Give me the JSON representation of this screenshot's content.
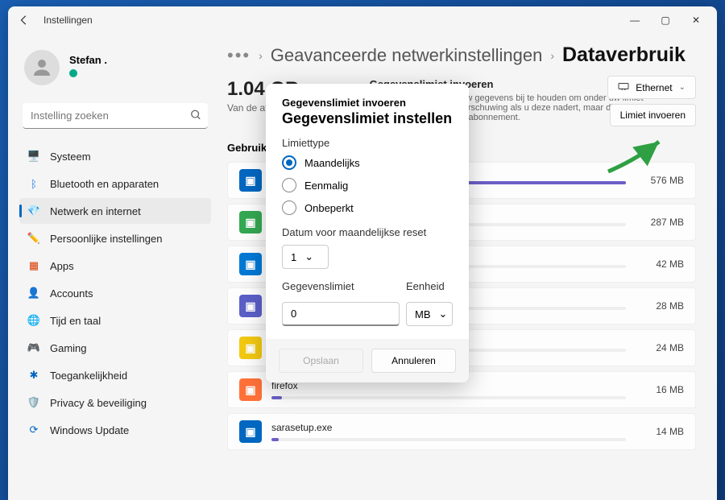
{
  "window": {
    "title": "Instellingen"
  },
  "account": {
    "name": "Stefan ."
  },
  "search": {
    "placeholder": "Instelling zoeken"
  },
  "sidebar": {
    "items": [
      {
        "label": "Systeem",
        "icon": "🖥️",
        "color": "#1a73e8"
      },
      {
        "label": "Bluetooth en apparaten",
        "icon": "ᛒ",
        "color": "#1a73e8"
      },
      {
        "label": "Netwerk en internet",
        "icon": "💎",
        "color": "#1a73e8",
        "active": true
      },
      {
        "label": "Persoonlijke instellingen",
        "icon": "✏️",
        "color": "#b36b00"
      },
      {
        "label": "Apps",
        "icon": "▦",
        "color": "#d83b01"
      },
      {
        "label": "Accounts",
        "icon": "👤",
        "color": "#5b5fc7"
      },
      {
        "label": "Tijd en taal",
        "icon": "🌐",
        "color": "#107c10"
      },
      {
        "label": "Gaming",
        "icon": "🎮",
        "color": "#888"
      },
      {
        "label": "Toegankelijkheid",
        "icon": "✱",
        "color": "#0067c0"
      },
      {
        "label": "Privacy & beveiliging",
        "icon": "🛡️",
        "color": "#666"
      },
      {
        "label": "Windows Update",
        "icon": "⟳",
        "color": "#0067c0"
      }
    ]
  },
  "breadcrumb": {
    "prev": "Geavanceerde netwerkinstellingen",
    "current": "Dataverbruik"
  },
  "usage": {
    "amount": "1.04 GB",
    "subtitle": "Van de afgelopen 30 dagen"
  },
  "limitInfo": {
    "title": "Gegevenslimiet invoeren",
    "text": "Windows kan u helpen uw gegevens bij te houden om onder uw limiet te blijven. U ziet een waarschuwing als u deze nadert, maar dit heeft geen invloed op uw data-abonnement."
  },
  "topButtons": {
    "adapter": "Ethernet",
    "enterLimit": "Limiet invoeren"
  },
  "usageSection": {
    "label": "Gebruik per app"
  },
  "apps": [
    {
      "name": "",
      "size": "576 MB",
      "pct": 100,
      "bg": "#0067c0"
    },
    {
      "name": "",
      "size": "287 MB",
      "pct": 50,
      "bg": "#34a853"
    },
    {
      "name": "",
      "size": "42 MB",
      "pct": 8,
      "bg": "#0078d4"
    },
    {
      "name": "",
      "size": "28 MB",
      "pct": 5,
      "bg": "#5b5fc7"
    },
    {
      "name": "",
      "size": "24 MB",
      "pct": 4,
      "bg": "#f2c811"
    },
    {
      "name": "firefox",
      "size": "16 MB",
      "pct": 3,
      "bg": "#ff7139"
    },
    {
      "name": "sarasetup.exe",
      "size": "14 MB",
      "pct": 2,
      "bg": "#0067c0"
    }
  ],
  "modal": {
    "subtitle": "Gegevenslimiet invoeren",
    "title": "Gegevenslimiet instellen",
    "limitTypeLabel": "Limiettype",
    "options": [
      {
        "label": "Maandelijks",
        "checked": true
      },
      {
        "label": "Eenmalig",
        "checked": false
      },
      {
        "label": "Onbeperkt",
        "checked": false
      }
    ],
    "resetDateLabel": "Datum voor maandelijkse reset",
    "resetDateValue": "1",
    "dataLimitLabel": "Gegevenslimiet",
    "dataLimitValue": "0",
    "unitLabel": "Eenheid",
    "unitValue": "MB",
    "saveLabel": "Opslaan",
    "cancelLabel": "Annuleren"
  }
}
